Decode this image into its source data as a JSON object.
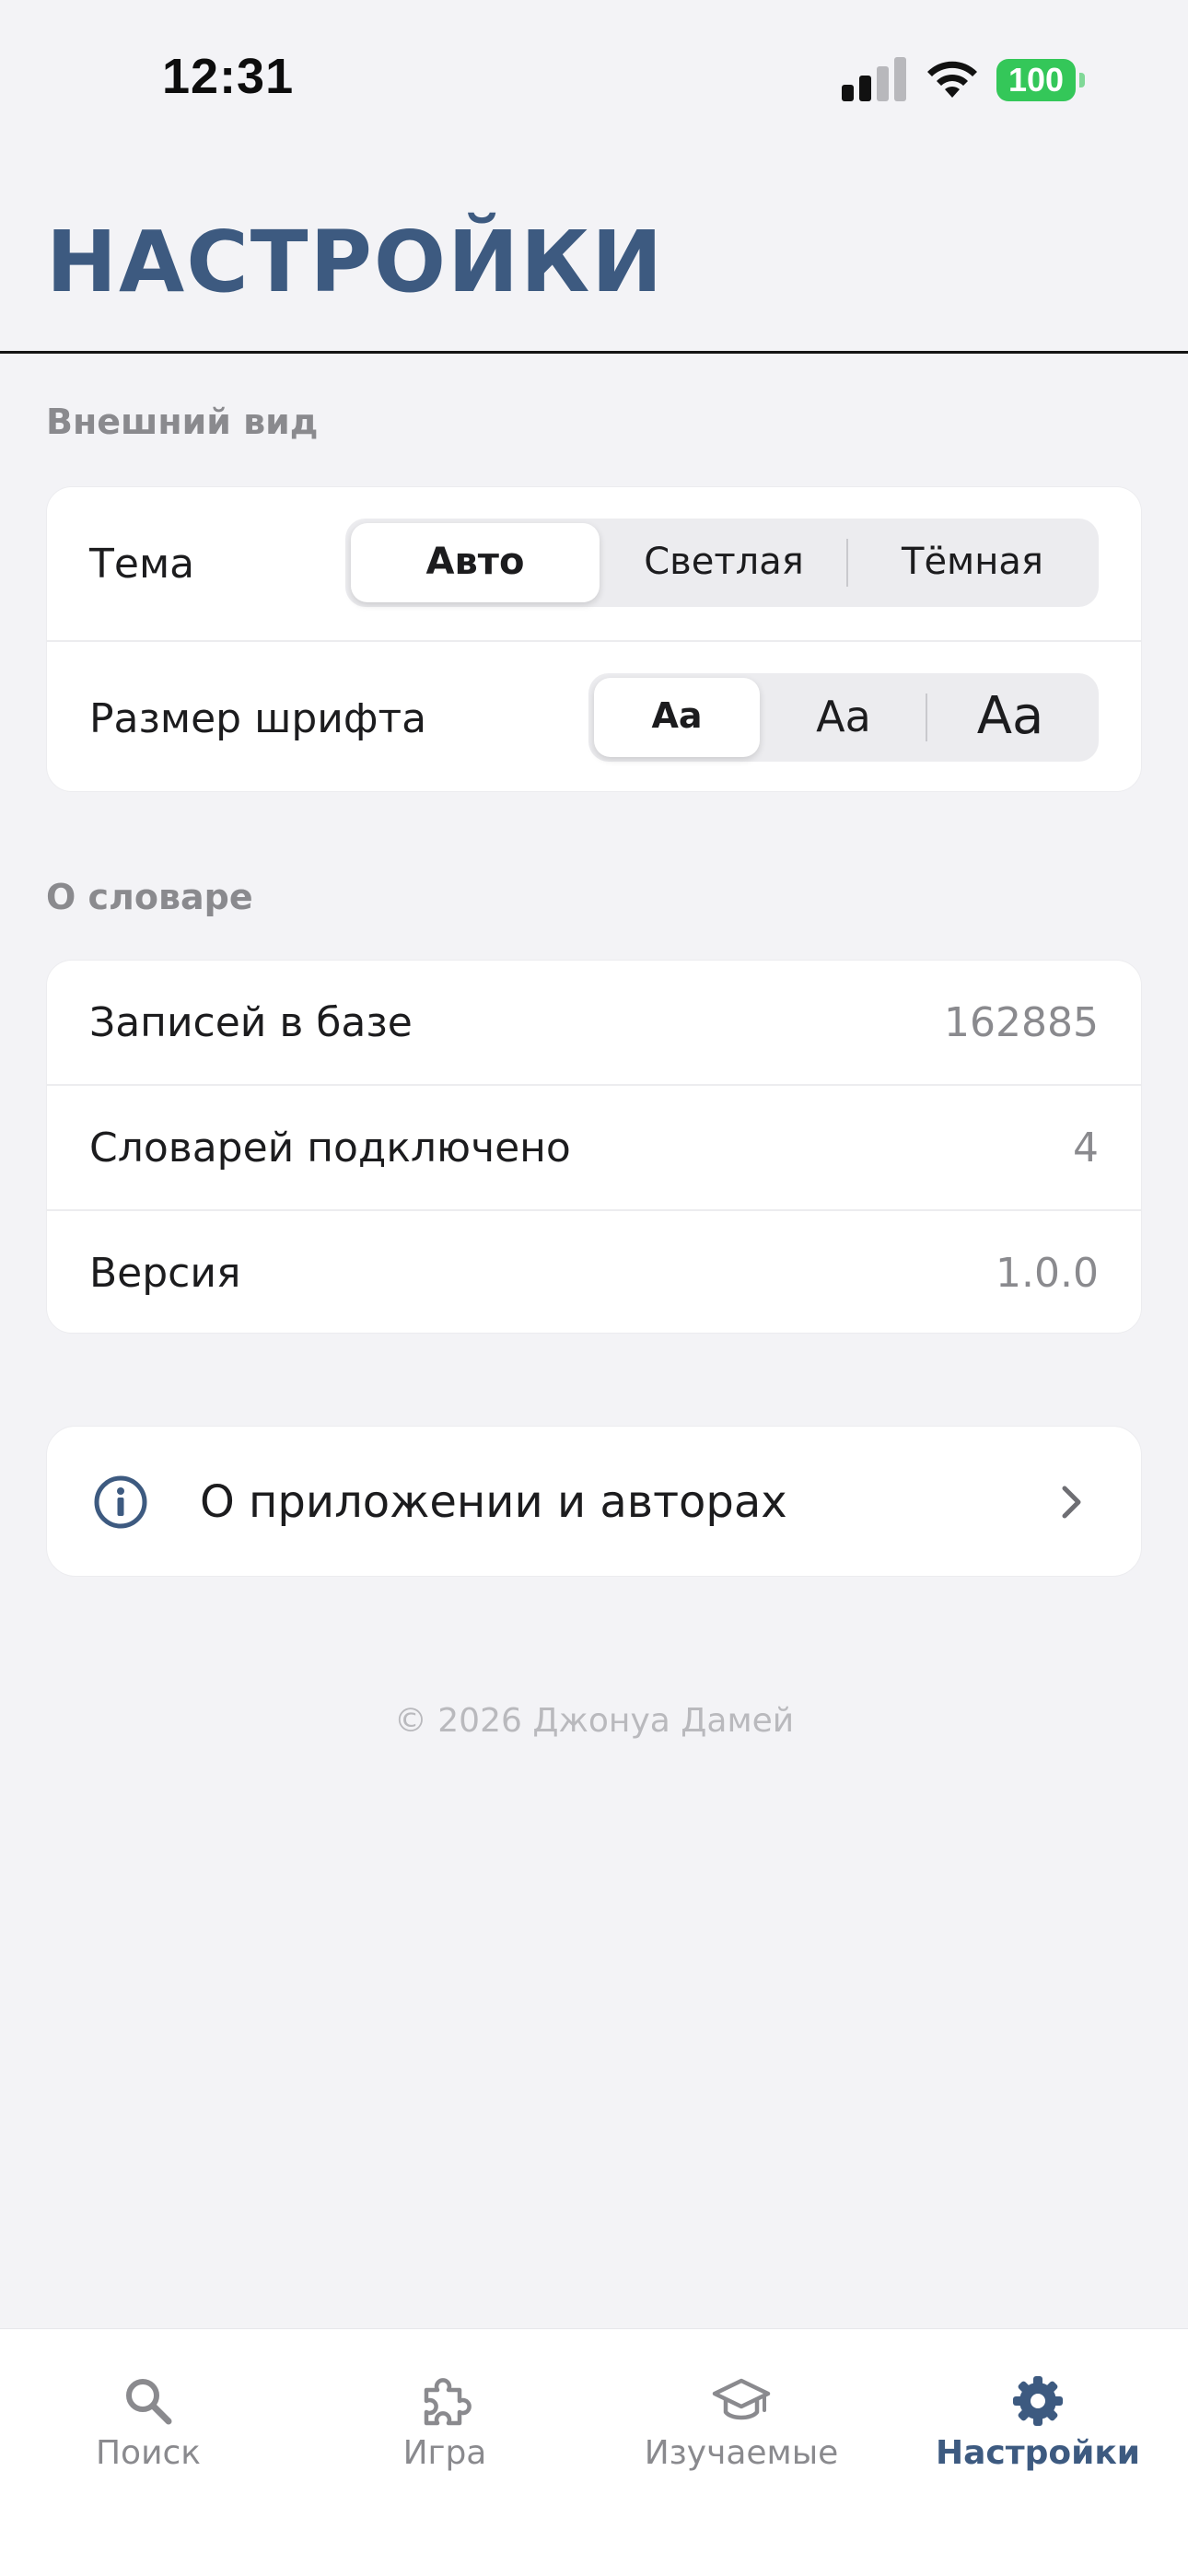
{
  "status_bar": {
    "time": "12:31",
    "battery": "100"
  },
  "header": {
    "title": "НАСТРОЙКИ"
  },
  "appearance": {
    "section_label": "Внешний вид",
    "theme": {
      "label": "Тема",
      "options": [
        "Авто",
        "Светлая",
        "Тёмная"
      ],
      "selected": "Авто"
    },
    "font_size": {
      "label": "Размер шрифта",
      "options": [
        "Aa",
        "Aa",
        "Aa"
      ],
      "selected_index": 0
    }
  },
  "dictionary": {
    "section_label": "О словаре",
    "rows": [
      {
        "label": "Записей в базе",
        "value": "162885"
      },
      {
        "label": "Словарей подключено",
        "value": "4"
      },
      {
        "label": "Версия",
        "value": "1.0.0"
      }
    ]
  },
  "about": {
    "label": "О приложении и авторах",
    "icon": "info-circle-icon",
    "chevron": "chevron-right-icon"
  },
  "footer": {
    "copyright": "© 2026 Джонуа Дамей"
  },
  "tabbar": {
    "items": [
      {
        "label": "Поиск",
        "icon": "search-icon",
        "active": false
      },
      {
        "label": "Игра",
        "icon": "puzzle-icon",
        "active": false
      },
      {
        "label": "Изучаемые",
        "icon": "graduation-cap-icon",
        "active": false
      },
      {
        "label": "Настройки",
        "icon": "gear-icon",
        "active": true
      }
    ]
  },
  "colors": {
    "accent": "#3d5a80",
    "battery": "#34c759",
    "background": "#f3f3f6"
  }
}
